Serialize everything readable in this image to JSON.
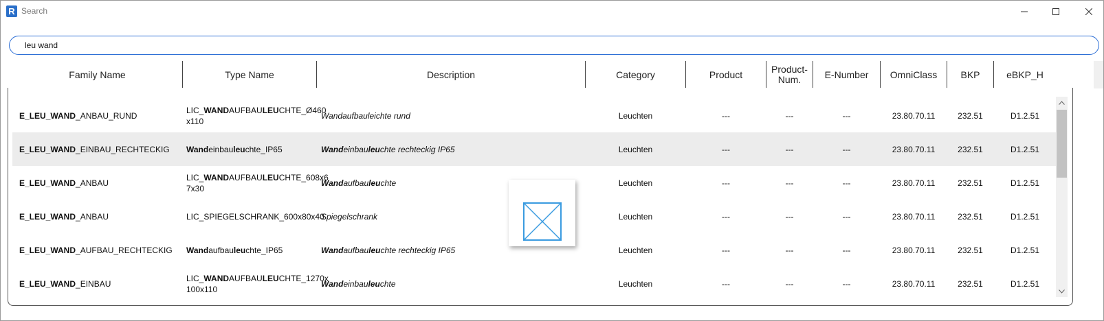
{
  "window": {
    "title": "Search",
    "app_icon_letter": "R"
  },
  "search": {
    "value": "leu wand"
  },
  "columns": [
    "Family Name",
    "Type Name",
    "Description",
    "Category",
    "Product",
    "Product-\nNum.",
    "E-Number",
    "OmniClass",
    "BKP",
    "eBKP_H"
  ],
  "rows": [
    {
      "family": [
        {
          "t": "E_",
          "b": true
        },
        {
          "t": "LEU",
          "b": true
        },
        {
          "t": "_",
          "b": true
        },
        {
          "t": "WAND",
          "b": true
        },
        {
          "t": "_ANBAU_RUND",
          "b": false
        }
      ],
      "type": [
        {
          "t": "LIC_",
          "b": false
        },
        {
          "t": "WAND",
          "b": true
        },
        {
          "t": "AUFBAU",
          "b": false
        },
        {
          "t": "LEU",
          "b": true
        },
        {
          "t": "CHTE_Ø460",
          "b": false
        },
        {
          "t": "\nx110",
          "b": false
        }
      ],
      "description": [
        {
          "t": "Wandaufbauleichte rund",
          "b": false
        }
      ],
      "category": "Leuchten",
      "product": "---",
      "product_num": "---",
      "e_number": "---",
      "omniclass": "23.80.70.11",
      "bkp": "232.51",
      "ebkp_h": "D1.2.51",
      "selected": false
    },
    {
      "family": [
        {
          "t": "E_LEU_WAND",
          "b": true
        },
        {
          "t": "_EINBAU_RECHTECKIG",
          "b": false
        }
      ],
      "type": [
        {
          "t": "Wand",
          "b": true
        },
        {
          "t": "einbau",
          "b": false
        },
        {
          "t": "leu",
          "b": true
        },
        {
          "t": "chte_IP65",
          "b": false
        }
      ],
      "description": [
        {
          "t": "Wand",
          "b": true
        },
        {
          "t": "einbau",
          "b": false
        },
        {
          "t": "leu",
          "b": true
        },
        {
          "t": "chte rechteckig IP65",
          "b": false
        }
      ],
      "category": "Leuchten",
      "product": "---",
      "product_num": "---",
      "e_number": "---",
      "omniclass": "23.80.70.11",
      "bkp": "232.51",
      "ebkp_h": "D1.2.51",
      "selected": true
    },
    {
      "family": [
        {
          "t": "E_LEU_WAND",
          "b": true
        },
        {
          "t": "_ANBAU",
          "b": false
        }
      ],
      "type": [
        {
          "t": "LIC_",
          "b": false
        },
        {
          "t": "WAND",
          "b": true
        },
        {
          "t": "AUFBAU",
          "b": false
        },
        {
          "t": "LEU",
          "b": true
        },
        {
          "t": "CHTE_608x6",
          "b": false
        },
        {
          "t": "\n7x30",
          "b": false
        }
      ],
      "description": [
        {
          "t": "Wand",
          "b": true
        },
        {
          "t": "aufbau",
          "b": false
        },
        {
          "t": "leu",
          "b": true
        },
        {
          "t": "chte",
          "b": false
        }
      ],
      "category": "Leuchten",
      "product": "---",
      "product_num": "---",
      "e_number": "---",
      "omniclass": "23.80.70.11",
      "bkp": "232.51",
      "ebkp_h": "D1.2.51",
      "selected": false
    },
    {
      "family": [
        {
          "t": "E_LEU_WAND",
          "b": true
        },
        {
          "t": "_ANBAU",
          "b": false
        }
      ],
      "type": [
        {
          "t": "LIC_SPIEGELSCHRANK_600x80x40",
          "b": false
        }
      ],
      "description": [
        {
          "t": "Spiegelschrank",
          "b": false
        }
      ],
      "category": "Leuchten",
      "product": "---",
      "product_num": "---",
      "e_number": "---",
      "omniclass": "23.80.70.11",
      "bkp": "232.51",
      "ebkp_h": "D1.2.51",
      "selected": false
    },
    {
      "family": [
        {
          "t": "E_LEU_WAND",
          "b": true
        },
        {
          "t": "_AUFBAU_RECHTECKIG",
          "b": false
        }
      ],
      "type": [
        {
          "t": "Wand",
          "b": true
        },
        {
          "t": "aufbau",
          "b": false
        },
        {
          "t": "leu",
          "b": true
        },
        {
          "t": "chte_IP65",
          "b": false
        }
      ],
      "description": [
        {
          "t": "Wand",
          "b": true
        },
        {
          "t": "aufbau",
          "b": false
        },
        {
          "t": "leu",
          "b": true
        },
        {
          "t": "chte rechteckig IP65",
          "b": false
        }
      ],
      "category": "Leuchten",
      "product": "---",
      "product_num": "---",
      "e_number": "---",
      "omniclass": "23.80.70.11",
      "bkp": "232.51",
      "ebkp_h": "D1.2.51",
      "selected": false
    },
    {
      "family": [
        {
          "t": "E_LEU_WAND",
          "b": true
        },
        {
          "t": "_EINBAU",
          "b": false
        }
      ],
      "type": [
        {
          "t": "LIC_",
          "b": false
        },
        {
          "t": "WAND",
          "b": true
        },
        {
          "t": "AUFBAU",
          "b": false
        },
        {
          "t": "LEU",
          "b": true
        },
        {
          "t": "CHTE_1270x",
          "b": false
        },
        {
          "t": "\n100x110",
          "b": false
        }
      ],
      "description": [
        {
          "t": "Wand",
          "b": true
        },
        {
          "t": "einbau",
          "b": false
        },
        {
          "t": "leu",
          "b": true
        },
        {
          "t": "chte",
          "b": false
        }
      ],
      "category": "Leuchten",
      "product": "---",
      "product_num": "---",
      "e_number": "---",
      "omniclass": "23.80.70.11",
      "bkp": "232.51",
      "ebkp_h": "D1.2.51",
      "selected": false
    }
  ],
  "icons": {
    "app": "revit-r-icon",
    "minimize": "minimize-icon",
    "maximize": "maximize-icon",
    "close": "close-icon",
    "preview": "missing-preview-icon",
    "scroll_up": "chevron-up-icon",
    "scroll_down": "chevron-down-icon"
  },
  "colors": {
    "accent": "#2d6fd6",
    "selected_row": "#ececec",
    "preview_icon": "#3a9be0"
  }
}
